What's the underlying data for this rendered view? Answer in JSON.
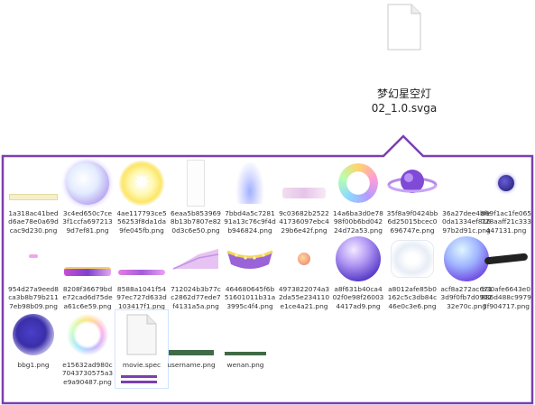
{
  "top_file": {
    "name_line1": "梦幻星空灯",
    "name_line2": "02_1.0.svga",
    "icon": "document-icon"
  },
  "callout_color": "#7b3fb1",
  "files": [
    {
      "label": "1a318ac41bedd6ae78e0a69dcac9d230.png"
    },
    {
      "label": "3c4ed650c7ce3f1ccfa6972139d7ef81.png"
    },
    {
      "label": "4ae117793ce556253f8da1da9fe045fb.png"
    },
    {
      "label": "6eaa5b8539698b13b7807e820d3c6e50.png"
    },
    {
      "label": "7bbd4a5c728191a13c76c9f4db946824.png"
    },
    {
      "label": "9c03682b252241736097ebc429b6e42f.png"
    },
    {
      "label": "14a6ba3d0e7898f00b6bd04224d72a53.png"
    },
    {
      "label": "35f8a9f0424bb6d25015bcec0696747e.png"
    },
    {
      "label": "36a27dee4bfe0da1334ef81697b2d91c.png"
    },
    {
      "label": "869f1ac1fe065728aaff21c333447131.png"
    },
    {
      "label": "954d27a9eed8ca3b8b79b2117eb98b09.png"
    },
    {
      "label": "8208f36679bde72cad6d75dea61c6e59.png"
    },
    {
      "label": "8588a1041f5497ec727d633d103417f1.png"
    },
    {
      "label": "712024b3b77cc2862d77ede7f4131a5a.png"
    },
    {
      "label": "464680645f6b51601011b31a3995c4f4.png"
    },
    {
      "label": "4973822074a32da55e234110e1ce4a21.png"
    },
    {
      "label": "a8f631b40ca402f0e98f260034417ad9.png"
    },
    {
      "label": "a8012afe85b0162c5c3db84c46e0c3e6.png"
    },
    {
      "label": "acf8a272ac6713d9f0fb7d090232e70c.png"
    },
    {
      "label": "b30afe6643e0886d488c99793f904717.png"
    },
    {
      "label": "bbg1.png"
    },
    {
      "label": "e15632ad980c7043730575a3e9a90487.png"
    },
    {
      "label": "movie.spec"
    },
    {
      "label": "username.png"
    },
    {
      "label": "wenan.png"
    }
  ]
}
